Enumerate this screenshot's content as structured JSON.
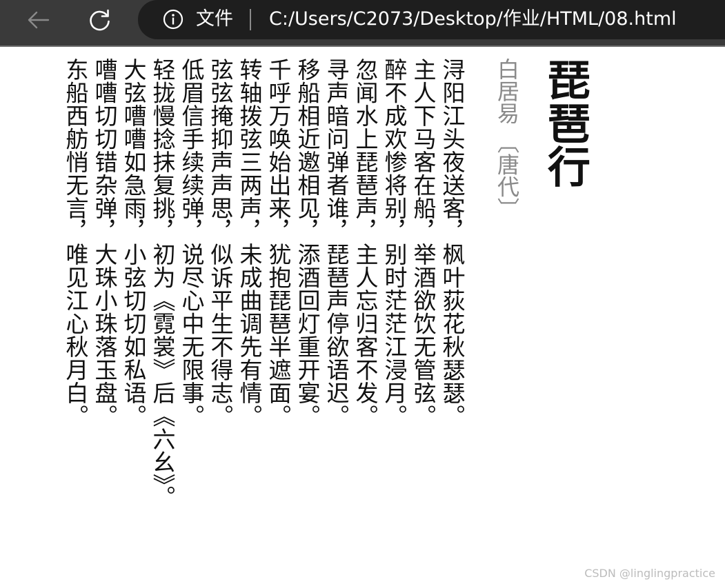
{
  "browser": {
    "site_label": "文件",
    "url": "C:/Users/C2073/Desktop/作业/HTML/08.html"
  },
  "poem": {
    "title": "琵琶行",
    "author": "白居易 〔唐代〕",
    "lines": [
      "浔阳江头夜送客，枫叶荻花秋瑟瑟。",
      "主人下马客在船，举酒欲饮无管弦。",
      "醉不成欢惨将别，别时茫茫江浸月。",
      "忽闻水上琵琶声，主人忘归客不发。",
      "寻声暗问弹者谁，琵琶声停欲语迟。",
      "移船相近邀相见，添酒回灯重开宴。",
      "千呼万唤始出来，犹抱琵琶半遮面。",
      "转轴拨弦三两声，未成曲调先有情。",
      "弦弦掩抑声声思，似诉平生不得志。",
      "低眉信手续续弹，说尽心中无限事。",
      "轻拢慢捻抹复挑，初为《霓裳》后《六幺》。",
      "大弦嘈嘈如急雨，小弦切切如私语。",
      "嘈嘈切切错杂弹，大珠小珠落玉盘。",
      "东船西舫悄无言，唯见江心秋月白。"
    ]
  },
  "watermark": "CSDN @linglingpractice"
}
